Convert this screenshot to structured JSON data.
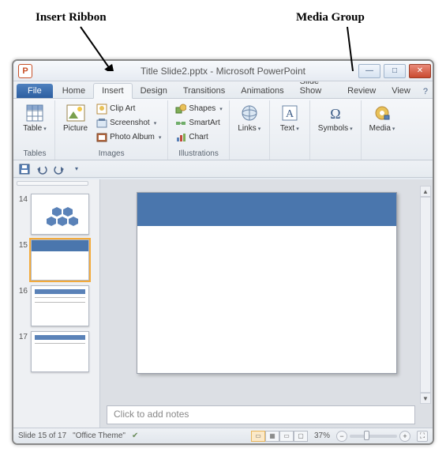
{
  "annotations": {
    "insert_ribbon": "Insert Ribbon",
    "media_group": "Media Group"
  },
  "app": {
    "icon_letter": "P",
    "title": "Title Slide2.pptx - Microsoft PowerPoint"
  },
  "tabs": {
    "file": "File",
    "home": "Home",
    "insert": "Insert",
    "design": "Design",
    "transitions": "Transitions",
    "animations": "Animations",
    "slideshow": "Slide Show",
    "review": "Review",
    "view": "View"
  },
  "ribbon": {
    "tables": {
      "group_label": "Tables",
      "table": "Table"
    },
    "images": {
      "group_label": "Images",
      "picture": "Picture",
      "clipart": "Clip Art",
      "screenshot": "Screenshot",
      "photoalbum": "Photo Album"
    },
    "illustrations": {
      "group_label": "Illustrations",
      "shapes": "Shapes",
      "smartart": "SmartArt",
      "chart": "Chart"
    },
    "links": {
      "group_label": "",
      "links": "Links"
    },
    "text": {
      "group_label": "",
      "text": "Text"
    },
    "symbols": {
      "group_label": "",
      "symbols": "Symbols"
    },
    "media": {
      "group_label": "",
      "media": "Media"
    }
  },
  "thumbs": {
    "n14": "14",
    "n15": "15",
    "n16": "16",
    "n17": "17"
  },
  "notes_placeholder": "Click to add notes",
  "status": {
    "slide": "Slide 15 of 17",
    "theme": "\"Office Theme\"",
    "zoom": "37%"
  }
}
